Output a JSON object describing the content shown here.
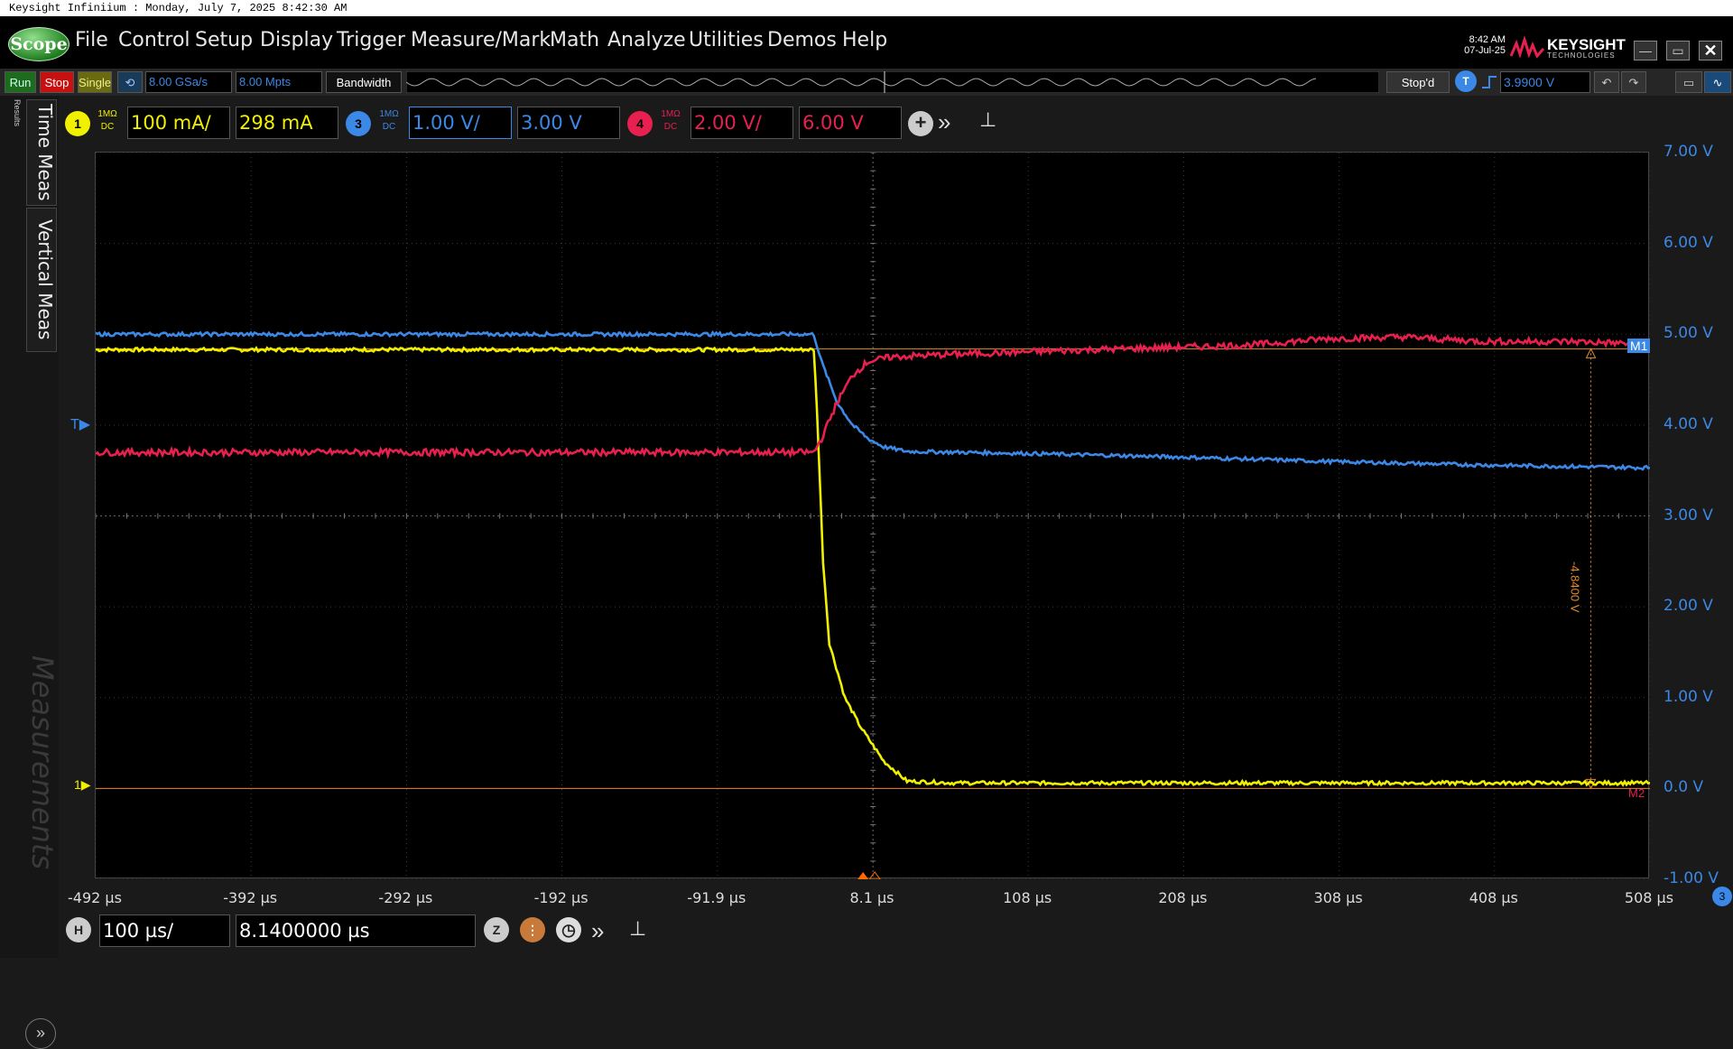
{
  "window": {
    "title": "Keysight Infiniium : Monday, July 7, 2025 8:42:30 AM"
  },
  "app": {
    "logo_label": "Scope"
  },
  "menu": {
    "items": [
      "File",
      "Control",
      "Setup",
      "Display",
      "Trigger",
      "Measure/Mark",
      "Math",
      "Analyze",
      "Utilities",
      "Demos",
      "Help"
    ]
  },
  "clock": {
    "time": "8:42 AM",
    "date": "07-Jul-25"
  },
  "brand": {
    "name": "KEYSIGHT",
    "sub": "TECHNOLOGIES"
  },
  "toolbar": {
    "run": "Run",
    "stop": "Stop",
    "single": "Single",
    "sample_rate": "8.00 GSa/s",
    "memory_depth": "8.00 Mpts",
    "bandwidth": "Bandwidth",
    "acq_status": "Stop'd",
    "trigger_source": "T",
    "trigger_level": "3.9900 V"
  },
  "channels": [
    {
      "num": "1",
      "coupling": "1MΩ",
      "dc": "DC",
      "scale": "100 mA/",
      "offset": "298 mA",
      "color": "#f0f000"
    },
    {
      "num": "3",
      "coupling": "1MΩ",
      "dc": "DC",
      "scale": "1.00 V/",
      "offset": "3.00 V",
      "color": "#3b88e6"
    },
    {
      "num": "4",
      "coupling": "1MΩ",
      "dc": "DC",
      "scale": "2.00 V/",
      "offset": "6.00 V",
      "color": "#e8204f"
    }
  ],
  "left_tabs": {
    "time": "Time Meas",
    "vertical": "Vertical Meas",
    "results": "Results",
    "watermark": "Measurements"
  },
  "markers": {
    "m1": "M1",
    "m2": "M2",
    "delta": "-4.8400 V",
    "trigger_marker": "T",
    "ch1_ground": "1"
  },
  "horizontal": {
    "icon": "H",
    "scale": "100 µs/",
    "position": "8.1400000 µs",
    "zoom_icon": "Z",
    "badge": "3"
  },
  "chart_data": {
    "type": "line",
    "title": "",
    "xlabel": "",
    "ylabel": "",
    "x_ticks": [
      "-492 µs",
      "-392 µs",
      "-292 µs",
      "-192 µs",
      "-91.9 µs",
      "8.1 µs",
      "108 µs",
      "208 µs",
      "308 µs",
      "408 µs",
      "508 µs"
    ],
    "y_ticks": [
      "7.00 V",
      "6.00 V",
      "5.00 V",
      "4.00 V",
      "3.00 V",
      "2.00 V",
      "1.00 V",
      "0.0 V",
      "-1.00 V"
    ],
    "xlim": [
      -492,
      508
    ],
    "ylim": [
      -1,
      7
    ],
    "grid": true,
    "series": [
      {
        "values": [
          [
            -492,
            4.83
          ],
          [
            -30,
            4.83
          ],
          [
            -28,
            4.2
          ],
          [
            -24,
            2.5
          ],
          [
            -20,
            1.6
          ],
          [
            -10,
            1.0
          ],
          [
            0,
            0.68
          ],
          [
            15,
            0.3
          ],
          [
            30,
            0.08
          ],
          [
            60,
            0.06
          ],
          [
            508,
            0.06
          ]
        ],
        "color": "#f0f000"
      },
      {
        "values": [
          [
            -492,
            5.0
          ],
          [
            -30,
            5.0
          ],
          [
            -25,
            4.7
          ],
          [
            -15,
            4.25
          ],
          [
            -5,
            4.0
          ],
          [
            5,
            3.85
          ],
          [
            15,
            3.76
          ],
          [
            30,
            3.71
          ],
          [
            100,
            3.69
          ],
          [
            200,
            3.65
          ],
          [
            300,
            3.6
          ],
          [
            400,
            3.56
          ],
          [
            508,
            3.53
          ]
        ],
        "color": "#3b88e6"
      },
      {
        "values": [
          [
            -492,
            3.7
          ],
          [
            -30,
            3.7
          ],
          [
            -25,
            3.85
          ],
          [
            -15,
            4.25
          ],
          [
            -5,
            4.55
          ],
          [
            5,
            4.7
          ],
          [
            20,
            4.75
          ],
          [
            60,
            4.78
          ],
          [
            150,
            4.83
          ],
          [
            250,
            4.88
          ],
          [
            300,
            4.95
          ],
          [
            350,
            4.97
          ],
          [
            400,
            4.92
          ],
          [
            460,
            4.92
          ],
          [
            490,
            4.9
          ],
          [
            508,
            4.88
          ]
        ],
        "color": "#e8204f"
      }
    ]
  },
  "colors": {
    "ch1": "#f0f000",
    "ch3": "#3b88e6",
    "ch4": "#e8204f",
    "marker": "#e68a2a"
  }
}
